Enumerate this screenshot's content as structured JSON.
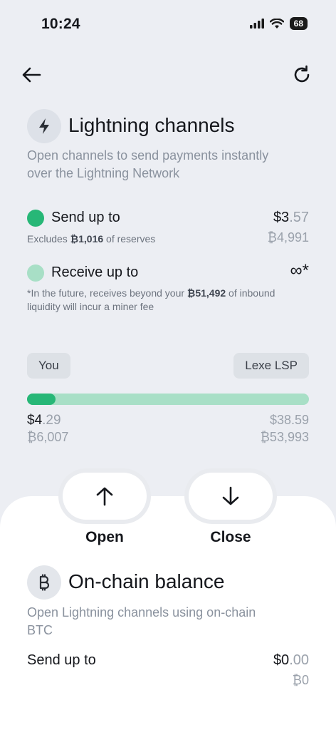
{
  "status_bar": {
    "time": "10:24",
    "battery": "68"
  },
  "lightning": {
    "title": "Lightning channels",
    "subtitle_line1": "Open channels to send payments instantly",
    "subtitle_line2": "over the Lightning Network",
    "send": {
      "label": "Send up to",
      "note_prefix": "Excludes ",
      "note_amount": "₿1,016",
      "note_suffix": " of reserves",
      "fiat_whole": "$3",
      "fiat_frac": ".57",
      "sats": "₿4,991",
      "color": "#27b777"
    },
    "receive": {
      "label": "Receive up to",
      "value": "∞*",
      "note_prefix": "*In the future, receives beyond your ",
      "note_amount": "₿51,492",
      "note_suffix_line1": " of inbound",
      "note_line2": "liquidity will incur a miner fee",
      "color": "#a8dfc6"
    },
    "channel_bar": {
      "you_label": "You",
      "lsp_label": "Lexe LSP",
      "you_fraction": 0.1,
      "you_fiat_whole": "$4",
      "you_fiat_frac": ".29",
      "you_sats": "₿6,007",
      "lsp_fiat": "$38.59",
      "lsp_sats": "₿53,993"
    }
  },
  "actions": {
    "open_label": "Open",
    "close_label": "Close"
  },
  "onchain": {
    "title": "On-chain balance",
    "subtitle_line1": "Open Lightning channels using on-chain",
    "subtitle_line2": "BTC",
    "send_label": "Send up to",
    "fiat_whole": "$0",
    "fiat_frac": ".00",
    "sats": "₿0"
  },
  "icons": {
    "back": "arrow-left-icon",
    "refresh": "refresh-icon",
    "lightning": "lightning-bolt-icon",
    "bitcoin": "bitcoin-icon",
    "open": "arrow-up-icon",
    "close": "arrow-down-icon"
  }
}
